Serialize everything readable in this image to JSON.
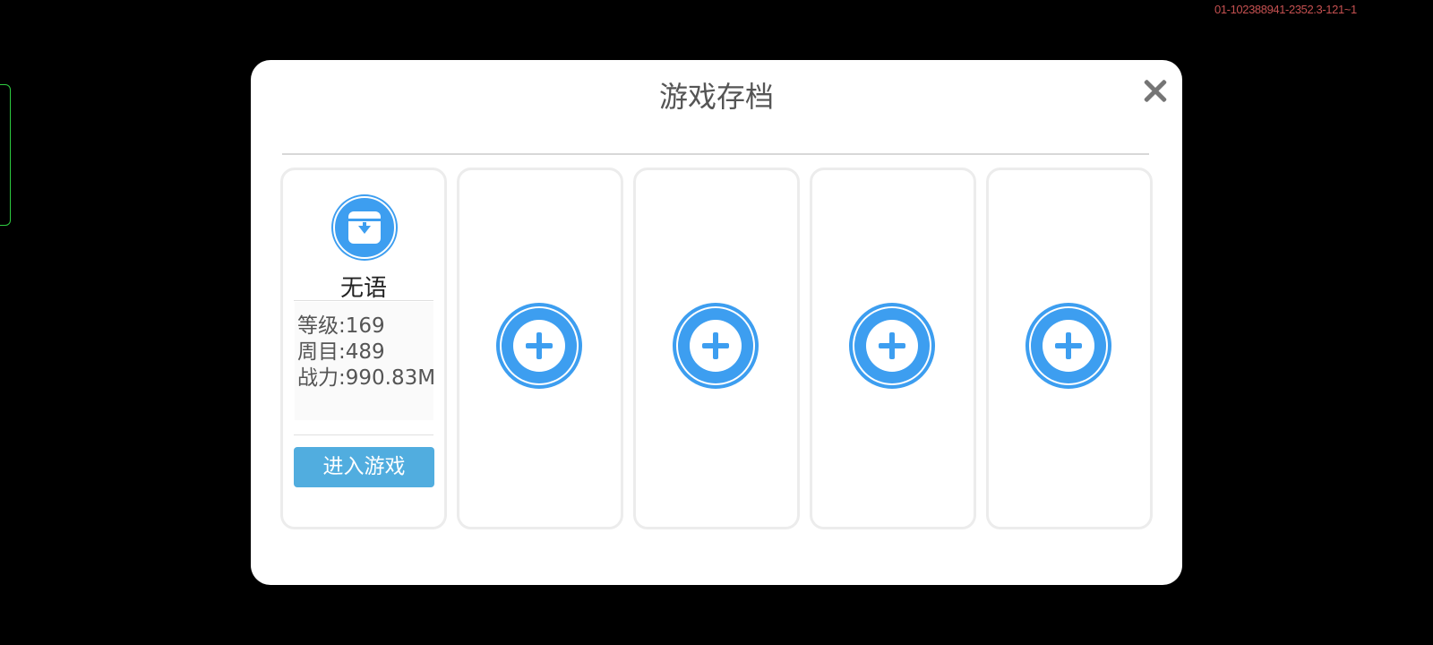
{
  "build_tag": "01-102388941-2352.3-121~1",
  "dialog": {
    "title": "游戏存档",
    "close_icon": "close-icon"
  },
  "colors": {
    "accent_blue": "#3d9ef0",
    "enter_button": "#51addf",
    "background": "#000000",
    "dialog_background": "#ffffff"
  },
  "slots": [
    {
      "state": "occupied",
      "icon": "save-download-icon",
      "player_name": "无语",
      "stats": {
        "level": "等级:169",
        "cycle": "周目:489",
        "power": "战力:990.83M"
      },
      "enter_label": "进入游戏"
    },
    {
      "state": "empty",
      "icon": "plus-circle-icon"
    },
    {
      "state": "empty",
      "icon": "plus-circle-icon"
    },
    {
      "state": "empty",
      "icon": "plus-circle-icon"
    },
    {
      "state": "empty",
      "icon": "plus-circle-icon"
    }
  ]
}
